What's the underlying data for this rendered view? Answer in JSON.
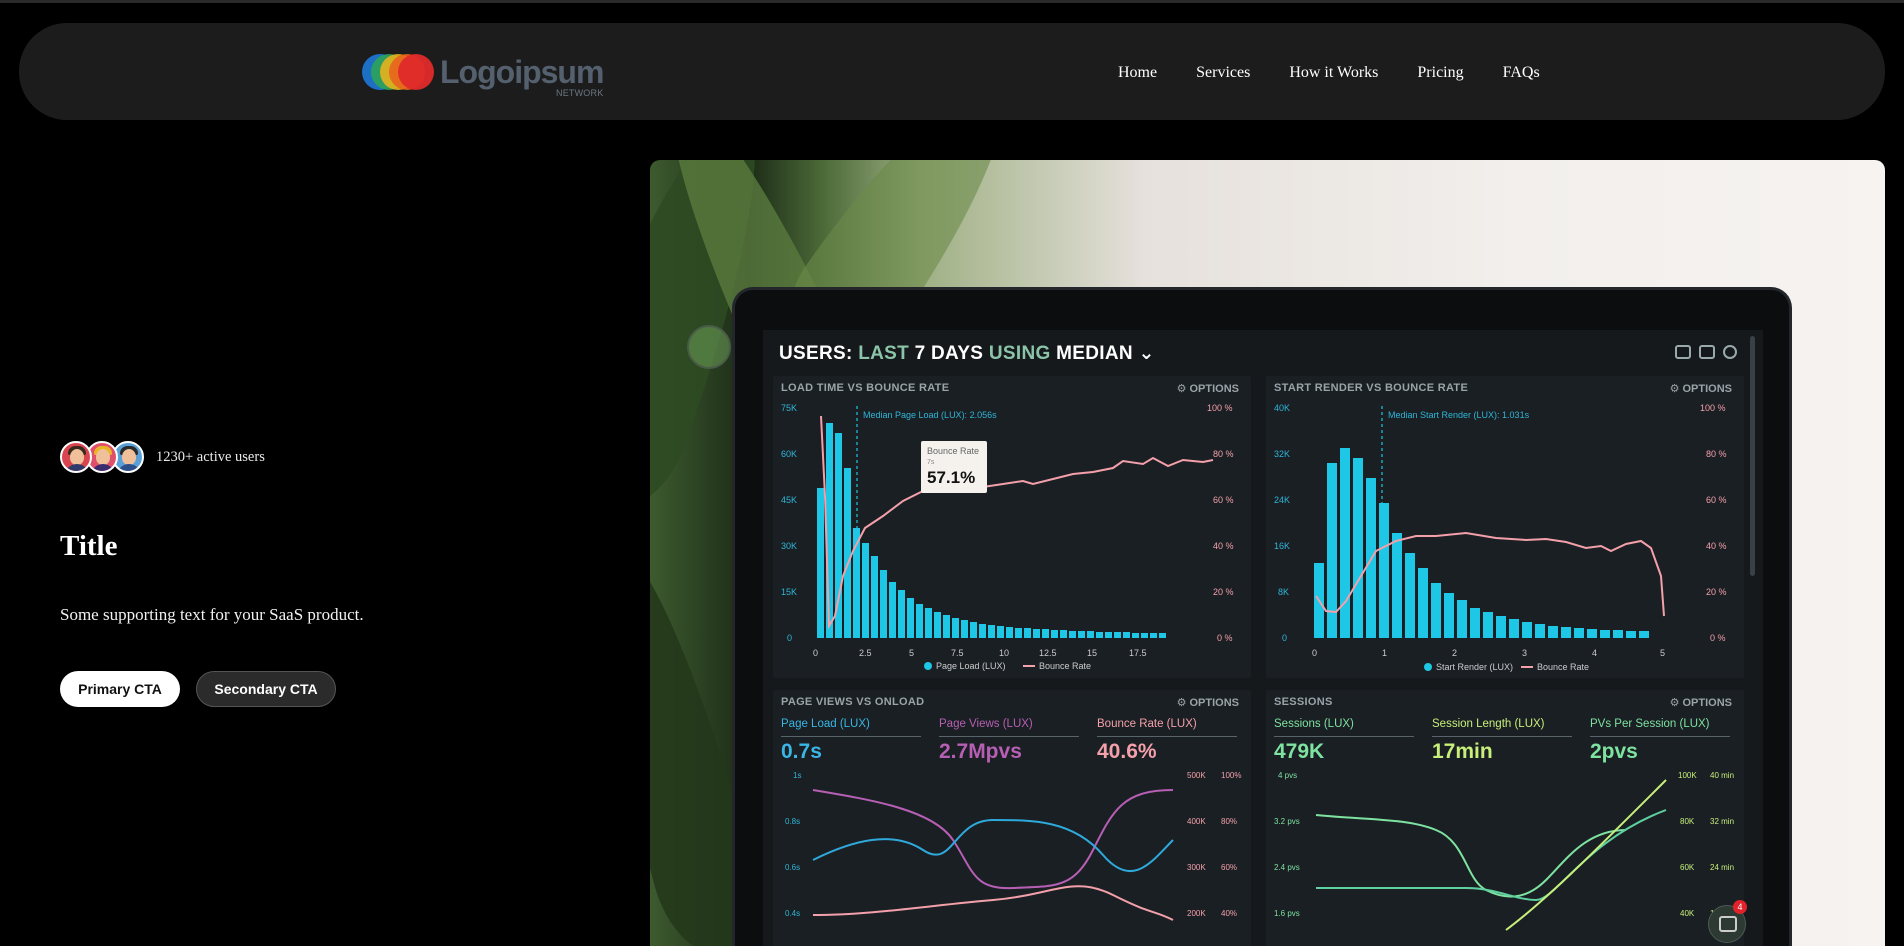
{
  "nav": {
    "logo_text": "Logoipsum",
    "logo_sub": "NETWORK",
    "links": [
      "Home",
      "Services",
      "How it Works",
      "Pricing",
      "FAQs"
    ]
  },
  "hero": {
    "active_users": "1230+ active users",
    "title": "Title",
    "subtitle": "Some supporting text for your SaaS product.",
    "primary_cta": "Primary CTA",
    "secondary_cta": "Secondary CTA"
  },
  "dashboard": {
    "heading_a": "USERS:",
    "heading_b": "LAST",
    "heading_c": "7 DAYS",
    "heading_d": "USING",
    "heading_e": "MEDIAN",
    "panel1_title": "LOAD TIME VS BOUNCE RATE",
    "panel2_title": "START RENDER VS BOUNCE RATE",
    "panel3_title": "PAGE VIEWS VS ONLOAD",
    "panel4_title": "SESSIONS",
    "options": "OPTIONS",
    "p1_median": "Median Page Load (LUX): 2.056s",
    "p2_median": "Median Start Render (LUX): 1.031s",
    "tooltip_label": "Bounce Rate",
    "tooltip_sub": "7s",
    "tooltip_value": "57.1%",
    "p1_legend_a": "Page Load (LUX)",
    "p1_legend_b": "Bounce Rate",
    "p2_legend_a": "Start Render (LUX)",
    "p2_legend_b": "Bounce Rate",
    "p3_metrics": [
      {
        "label": "Page Load (LUX)",
        "value": "0.7s"
      },
      {
        "label": "Page Views (LUX)",
        "value": "2.7Mpvs"
      },
      {
        "label": "Bounce Rate (LUX)",
        "value": "40.6%"
      }
    ],
    "p4_metrics": [
      {
        "label": "Sessions (LUX)",
        "value": "479K"
      },
      {
        "label": "Session Length (LUX)",
        "value": "17min"
      },
      {
        "label": "PVs Per Session (LUX)",
        "value": "2pvs"
      }
    ]
  },
  "chat_badge": "4",
  "colors": {
    "cyan": "#1fc7e6",
    "pink": "#f3a0ab",
    "purple": "#b65fb4",
    "green": "#7ee2a0",
    "lime": "#c7ef7a"
  }
}
